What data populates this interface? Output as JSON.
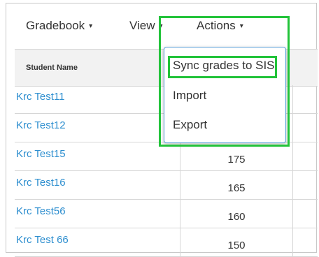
{
  "header": {
    "menus": [
      {
        "label": "Gradebook"
      },
      {
        "label": "View"
      },
      {
        "label": "Actions"
      }
    ],
    "caret": "▾"
  },
  "table": {
    "columns": [
      "Student Name"
    ],
    "rows": [
      {
        "name": "Krc Test11",
        "score": ""
      },
      {
        "name": "Krc Test12",
        "score": ""
      },
      {
        "name": "Krc Test15",
        "score": "175"
      },
      {
        "name": "Krc Test16",
        "score": "165"
      },
      {
        "name": "Krc Test56",
        "score": "160"
      },
      {
        "name": "Krc Test 66",
        "score": "150"
      }
    ]
  },
  "actions_menu": {
    "items": [
      {
        "label": "Sync grades to SIS"
      },
      {
        "label": "Import"
      },
      {
        "label": "Export"
      }
    ]
  },
  "colors": {
    "link": "#2d8ecf",
    "highlight": "#22c33a",
    "dropdown_border": "#5a9fd8"
  }
}
